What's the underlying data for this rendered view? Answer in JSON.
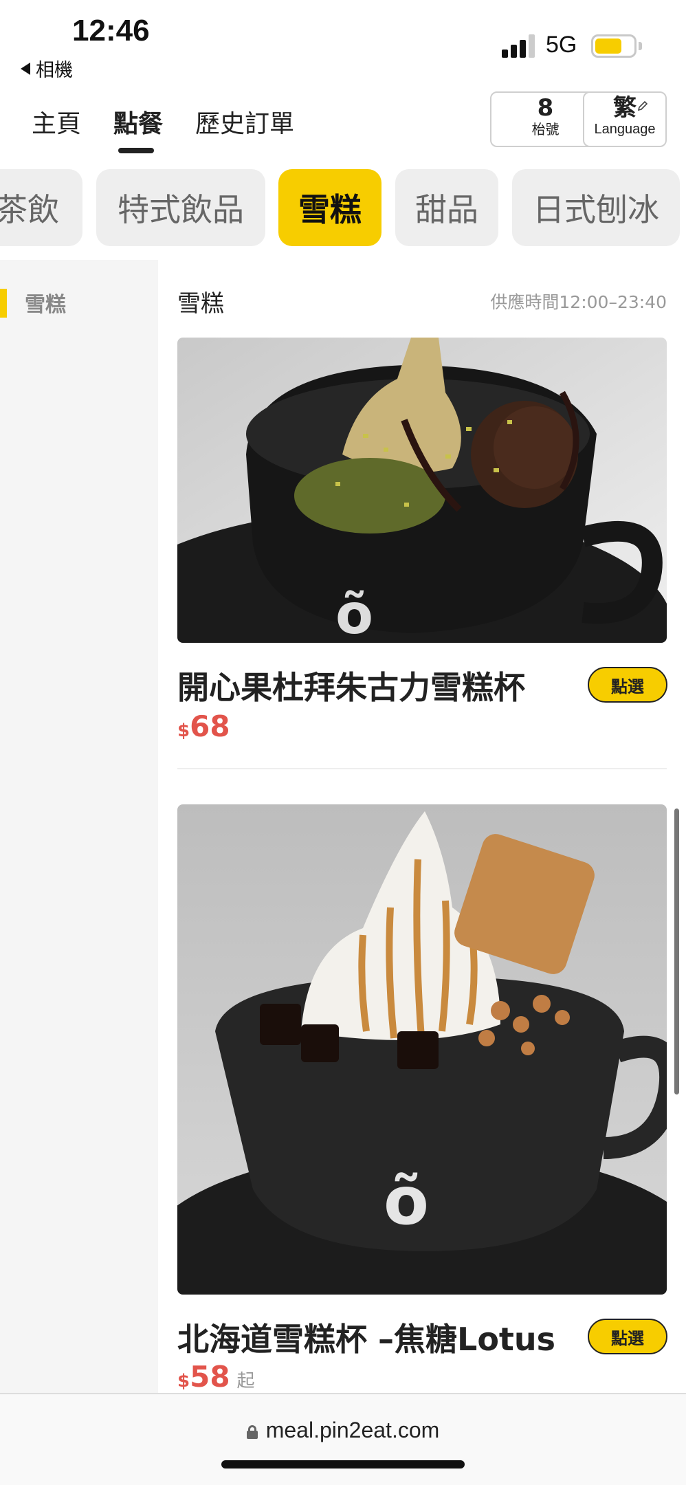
{
  "status_bar": {
    "time": "12:46",
    "back_app": "相機",
    "network": "5G",
    "battery_level": 0.7
  },
  "nav": {
    "tabs": [
      {
        "label": "主頁",
        "active": false
      },
      {
        "label": "點餐",
        "active": true
      },
      {
        "label": "歷史訂單",
        "active": false
      }
    ],
    "table": {
      "number": "8",
      "label": "枱號"
    },
    "language": {
      "current": "繁",
      "label": "Language"
    }
  },
  "categories": [
    {
      "label": "茶飲",
      "active": false
    },
    {
      "label": "特式飲品",
      "active": false
    },
    {
      "label": "雪糕",
      "active": true
    },
    {
      "label": "甜品",
      "active": false
    },
    {
      "label": "日式刨冰",
      "active": false
    }
  ],
  "sidebar": {
    "items": [
      {
        "label": "雪糕",
        "active": true
      }
    ]
  },
  "section": {
    "title": "雪糕",
    "serving_time": "供應時間12:00–23:40"
  },
  "products": [
    {
      "name": "開心果杜拜朱古力雪糕杯",
      "currency": "$",
      "price": "68",
      "suffix": "",
      "button": "點選"
    },
    {
      "name": "北海道雪糕杯 –焦糖Lotus",
      "currency": "$",
      "price": "58",
      "suffix": "起",
      "button": "點選"
    }
  ],
  "url_bar": {
    "url": "meal.pin2eat.com"
  },
  "colors": {
    "accent": "#f7cd00",
    "price": "#e2544b"
  }
}
